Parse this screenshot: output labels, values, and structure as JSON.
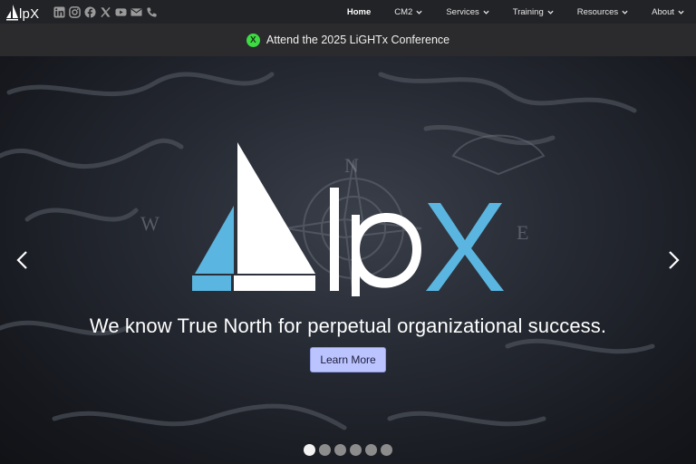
{
  "brand": {
    "name": "lpX",
    "icon": "sail-logo-icon"
  },
  "socials": [
    {
      "name": "linkedin-icon"
    },
    {
      "name": "instagram-icon"
    },
    {
      "name": "facebook-icon"
    },
    {
      "name": "x-icon"
    },
    {
      "name": "youtube-icon"
    },
    {
      "name": "mail-icon"
    },
    {
      "name": "phone-icon"
    }
  ],
  "nav": [
    {
      "label": "Home",
      "active": true,
      "dropdown": false
    },
    {
      "label": "CM2",
      "active": false,
      "dropdown": true
    },
    {
      "label": "Services",
      "active": false,
      "dropdown": true
    },
    {
      "label": "Training",
      "active": false,
      "dropdown": true
    },
    {
      "label": "Resources",
      "active": false,
      "dropdown": true
    },
    {
      "label": "About",
      "active": false,
      "dropdown": true
    }
  ],
  "announcement": {
    "badge": "X",
    "text": "Attend the 2025 LiGHTx Conference"
  },
  "hero": {
    "logo_text": "lpX",
    "tagline": "We know True North for perpetual organizational success.",
    "cta_label": "Learn More",
    "slides_total": 6,
    "slide_active": 1
  },
  "colors": {
    "accent_blue": "#5ab6e0",
    "cta_bg": "#bcc4ff",
    "badge_green": "#3ddc44"
  }
}
